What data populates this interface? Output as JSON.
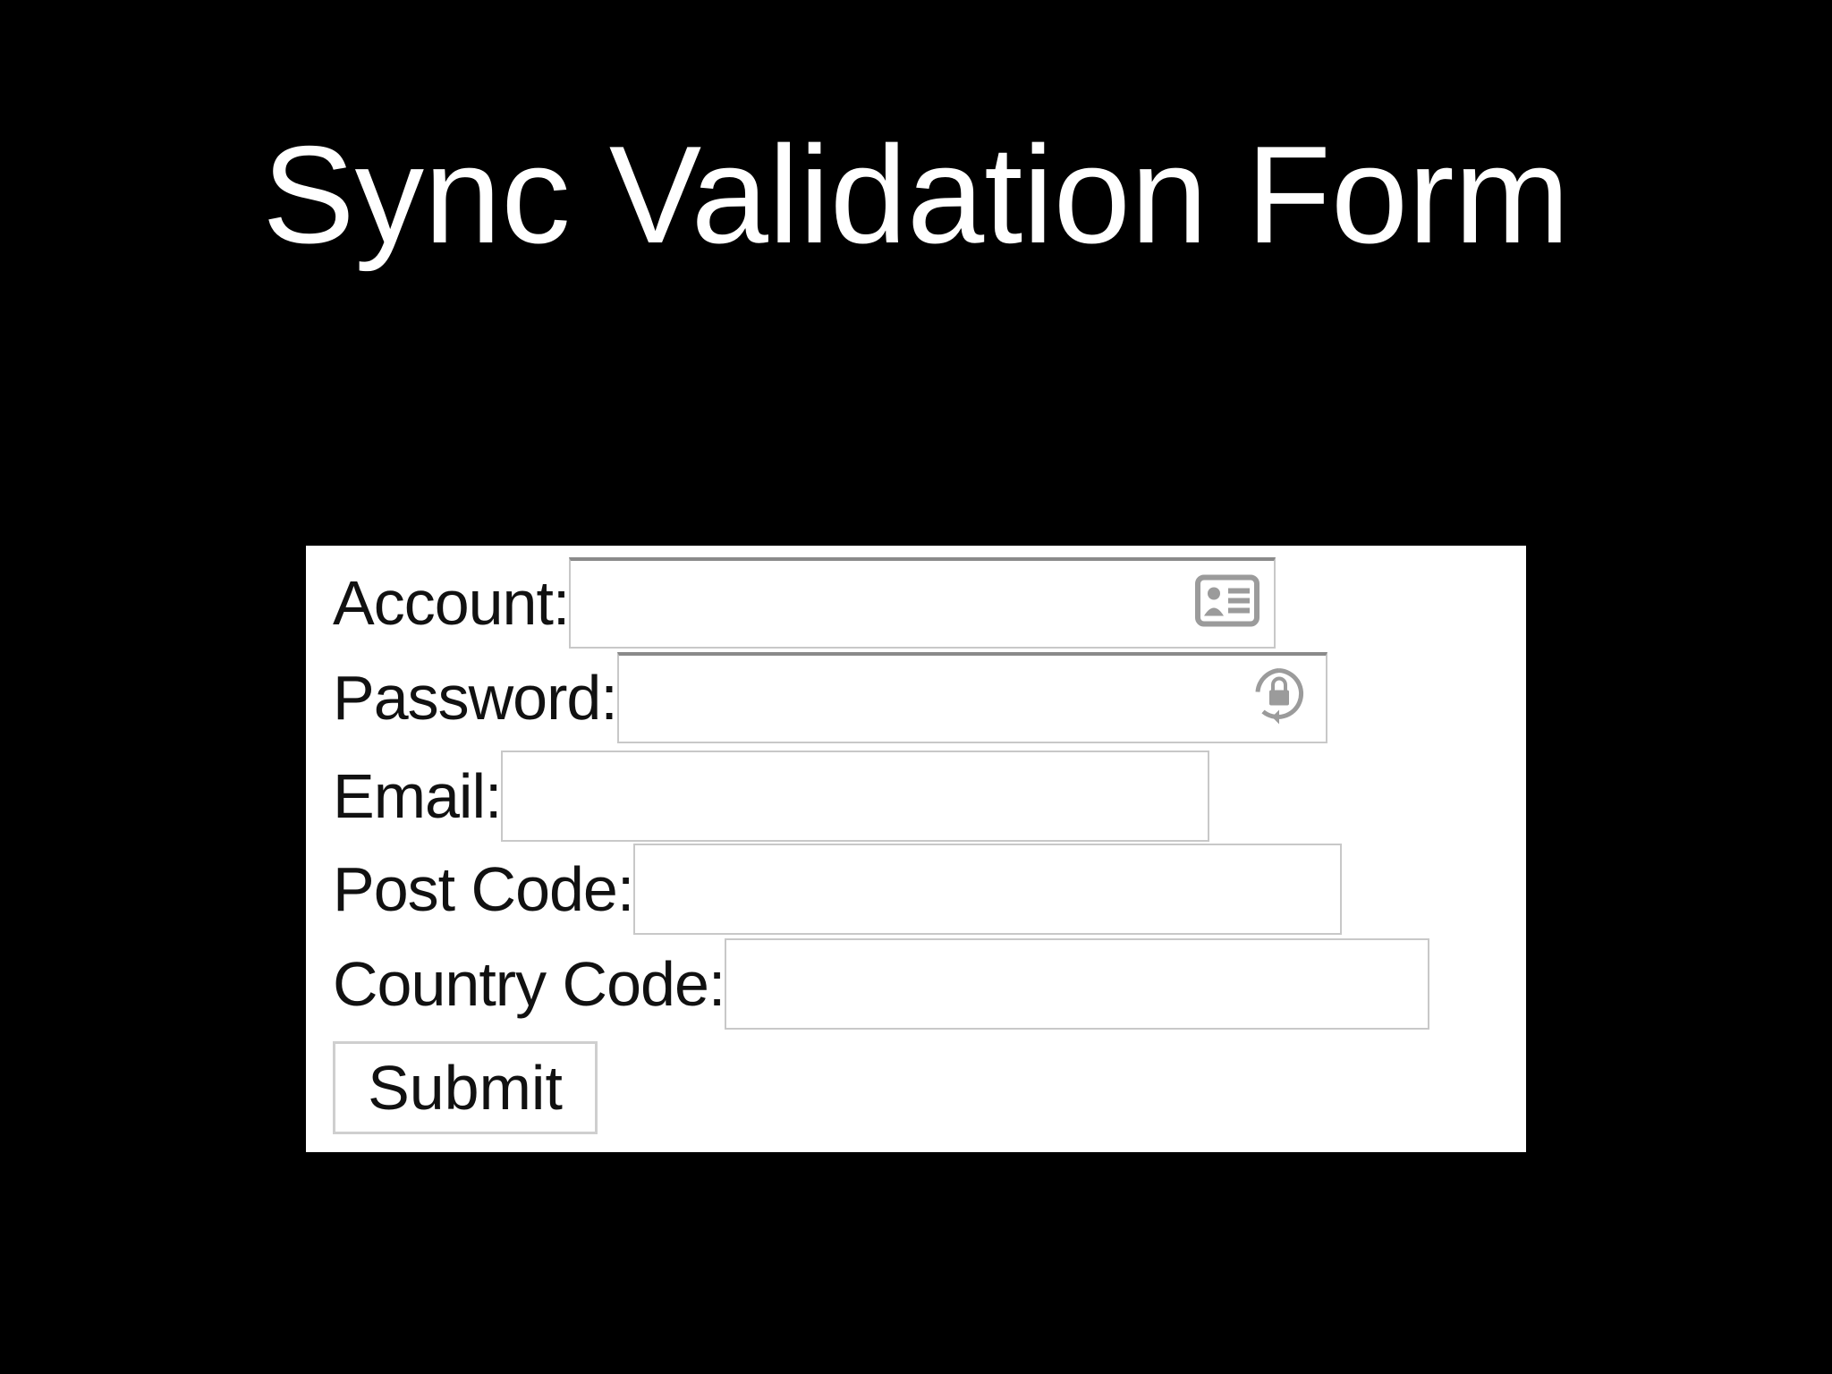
{
  "title": "Sync Validation Form",
  "form": {
    "fields": [
      {
        "label": "Account:",
        "value": "",
        "icon": "contact-card-icon"
      },
      {
        "label": "Password:",
        "value": "",
        "icon": "password-lock-icon"
      },
      {
        "label": "Email:",
        "value": ""
      },
      {
        "label": "Post Code:",
        "value": ""
      },
      {
        "label": "Country Code:",
        "value": ""
      }
    ],
    "submit_label": "Submit"
  }
}
